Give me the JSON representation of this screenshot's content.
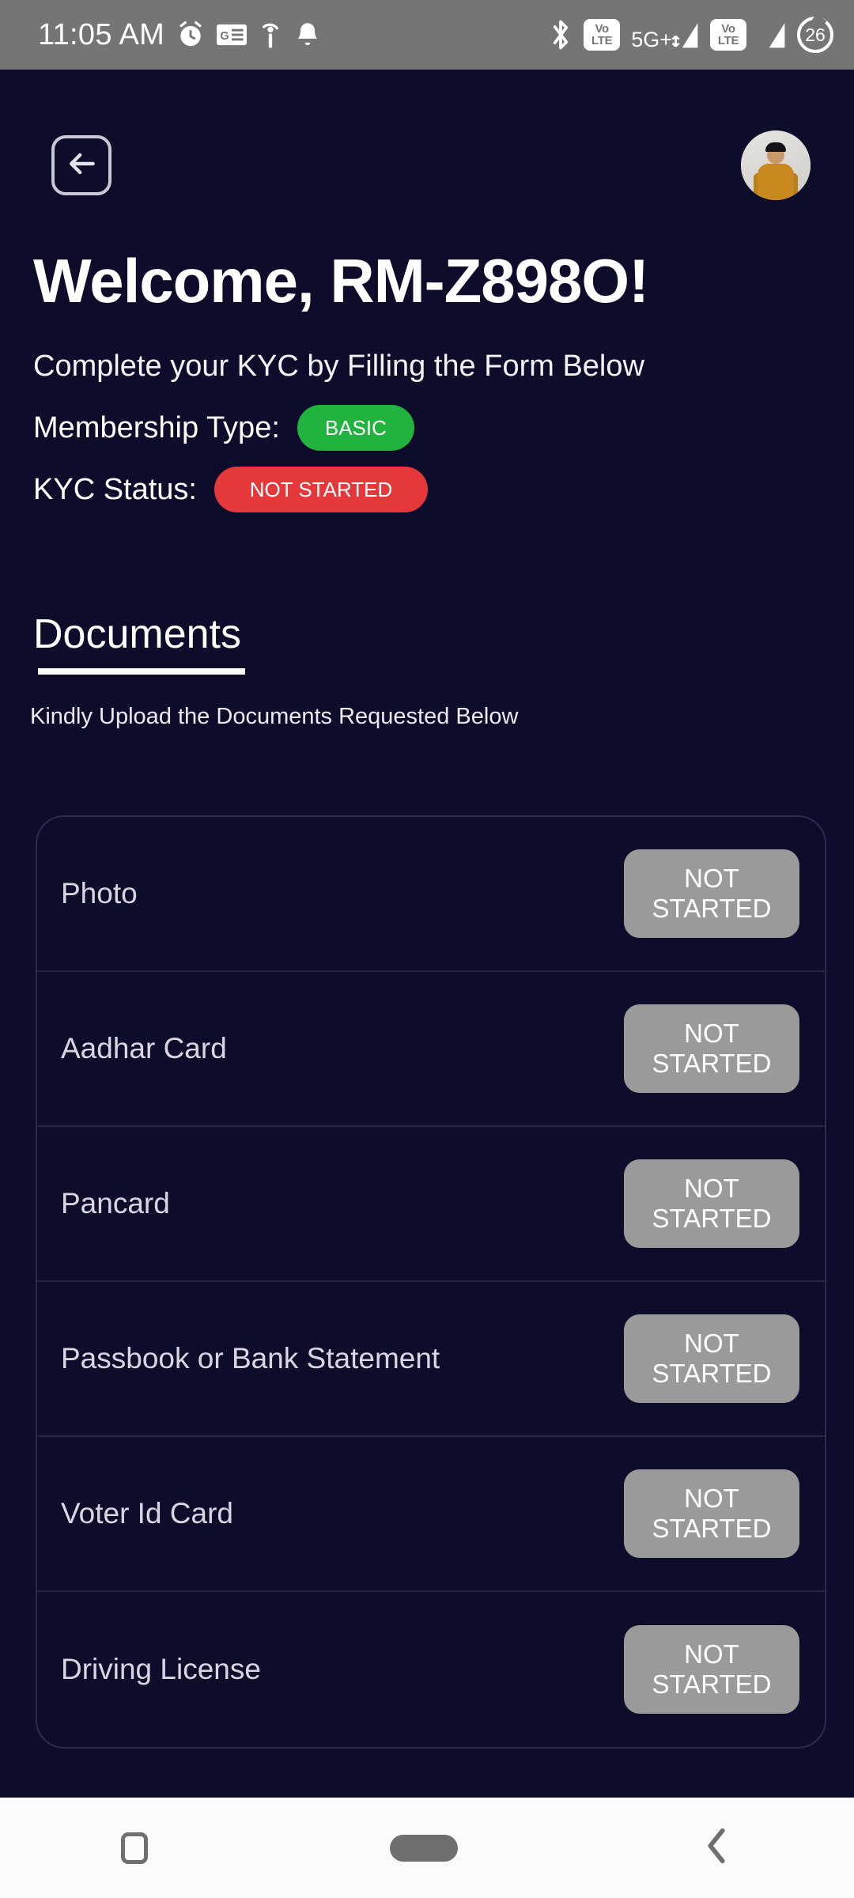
{
  "status_bar": {
    "time": "11:05 AM",
    "left_icons": [
      "alarm-clock-icon",
      "google-news-icon",
      "antenna-info-icon",
      "notification-bell-icon"
    ],
    "bluetooth_icon": "bluetooth-icon",
    "volte_primary": {
      "line1": "Vo",
      "line2": "LTE"
    },
    "network_type": "5G+",
    "volte_secondary": {
      "line1": "Vo",
      "line2": "LTE"
    },
    "battery_level": "26"
  },
  "header": {
    "back_icon": "arrow-left-icon",
    "avatar_icon": "user-avatar"
  },
  "hero": {
    "welcome_title": "Welcome, RM-Z898O!",
    "subtitle": "Complete your KYC by Filling the Form Below",
    "membership_label": "Membership Type:",
    "membership_value": "BASIC",
    "kyc_label": "KYC Status:",
    "kyc_value": "NOT STARTED"
  },
  "documents_section": {
    "title": "Documents",
    "subtitle": "Kindly Upload the Documents Requested Below",
    "rows": [
      {
        "label": "Photo",
        "status_line1": "NOT",
        "status_line2": "STARTED"
      },
      {
        "label": "Aadhar Card",
        "status_line1": "NOT",
        "status_line2": "STARTED"
      },
      {
        "label": "Pancard",
        "status_line1": "NOT",
        "status_line2": "STARTED"
      },
      {
        "label": "Passbook  or Bank Statement",
        "status_line1": "NOT",
        "status_line2": "STARTED"
      },
      {
        "label": "Voter Id Card",
        "status_line1": "NOT",
        "status_line2": "STARTED"
      },
      {
        "label": "Driving License",
        "status_line1": "NOT",
        "status_line2": "STARTED"
      }
    ]
  },
  "navigation_bar": {
    "recents_icon": "square-recents-icon",
    "home_icon": "home-pill-icon",
    "back_icon": "chevron-left-icon"
  },
  "colors": {
    "background": "#0d0d2b",
    "status_bar": "#757575",
    "membership_badge": "#22b33f",
    "kyc_badge": "#e5383b",
    "doc_status_button": "#9a9a9a",
    "nav_bar": "#fbfbfb"
  }
}
